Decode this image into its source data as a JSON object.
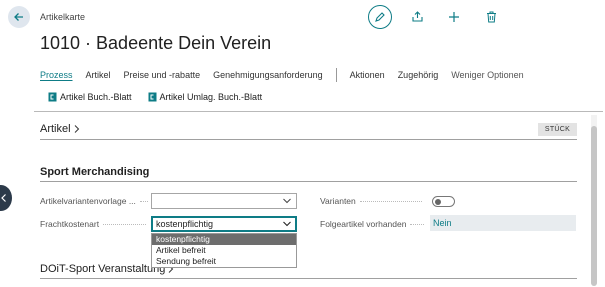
{
  "header": {
    "caption": "Artikelkarte",
    "title": "1010 · Badeente Dein Verein"
  },
  "top_actions": {
    "edit_icon": "pencil-icon",
    "share_icon": "share-icon",
    "new_icon": "plus-icon",
    "delete_icon": "trash-icon"
  },
  "menu": {
    "items": [
      "Prozess",
      "Artikel",
      "Preise und -rabatte",
      "Genehmigungsanforderung"
    ],
    "items_right": [
      "Aktionen",
      "Zugehörig",
      "Weniger Optionen"
    ]
  },
  "sub_actions": [
    {
      "label": "Artikel Buch.-Blatt",
      "icon": "journal-icon"
    },
    {
      "label": "Artikel Umlag. Buch.-Blatt",
      "icon": "journal-icon"
    }
  ],
  "sections": {
    "artikel": {
      "title": "Artikel",
      "badge": "STÜCK"
    },
    "sport": {
      "title": "Sport Merchandising"
    },
    "doit": {
      "title": "DOiT-Sport Veranstaltung"
    }
  },
  "fields": {
    "variant_template": {
      "label": "Artikelvariantenvorlage ...",
      "value": ""
    },
    "freight_type": {
      "label": "Frachtkostenart",
      "value": "kostenpflichtig"
    },
    "variants": {
      "label": "Varianten",
      "value": "off"
    },
    "follow_item": {
      "label": "Folgeartikel vorhanden",
      "value": "Nein"
    }
  },
  "dropdown": {
    "options": [
      "kostenpflichtig",
      "Artikel befreit",
      "Sendung befreit"
    ],
    "selected": "kostenpflichtig"
  },
  "colors": {
    "accent": "#0e7c86",
    "nav_dark": "#2c3a4a"
  }
}
